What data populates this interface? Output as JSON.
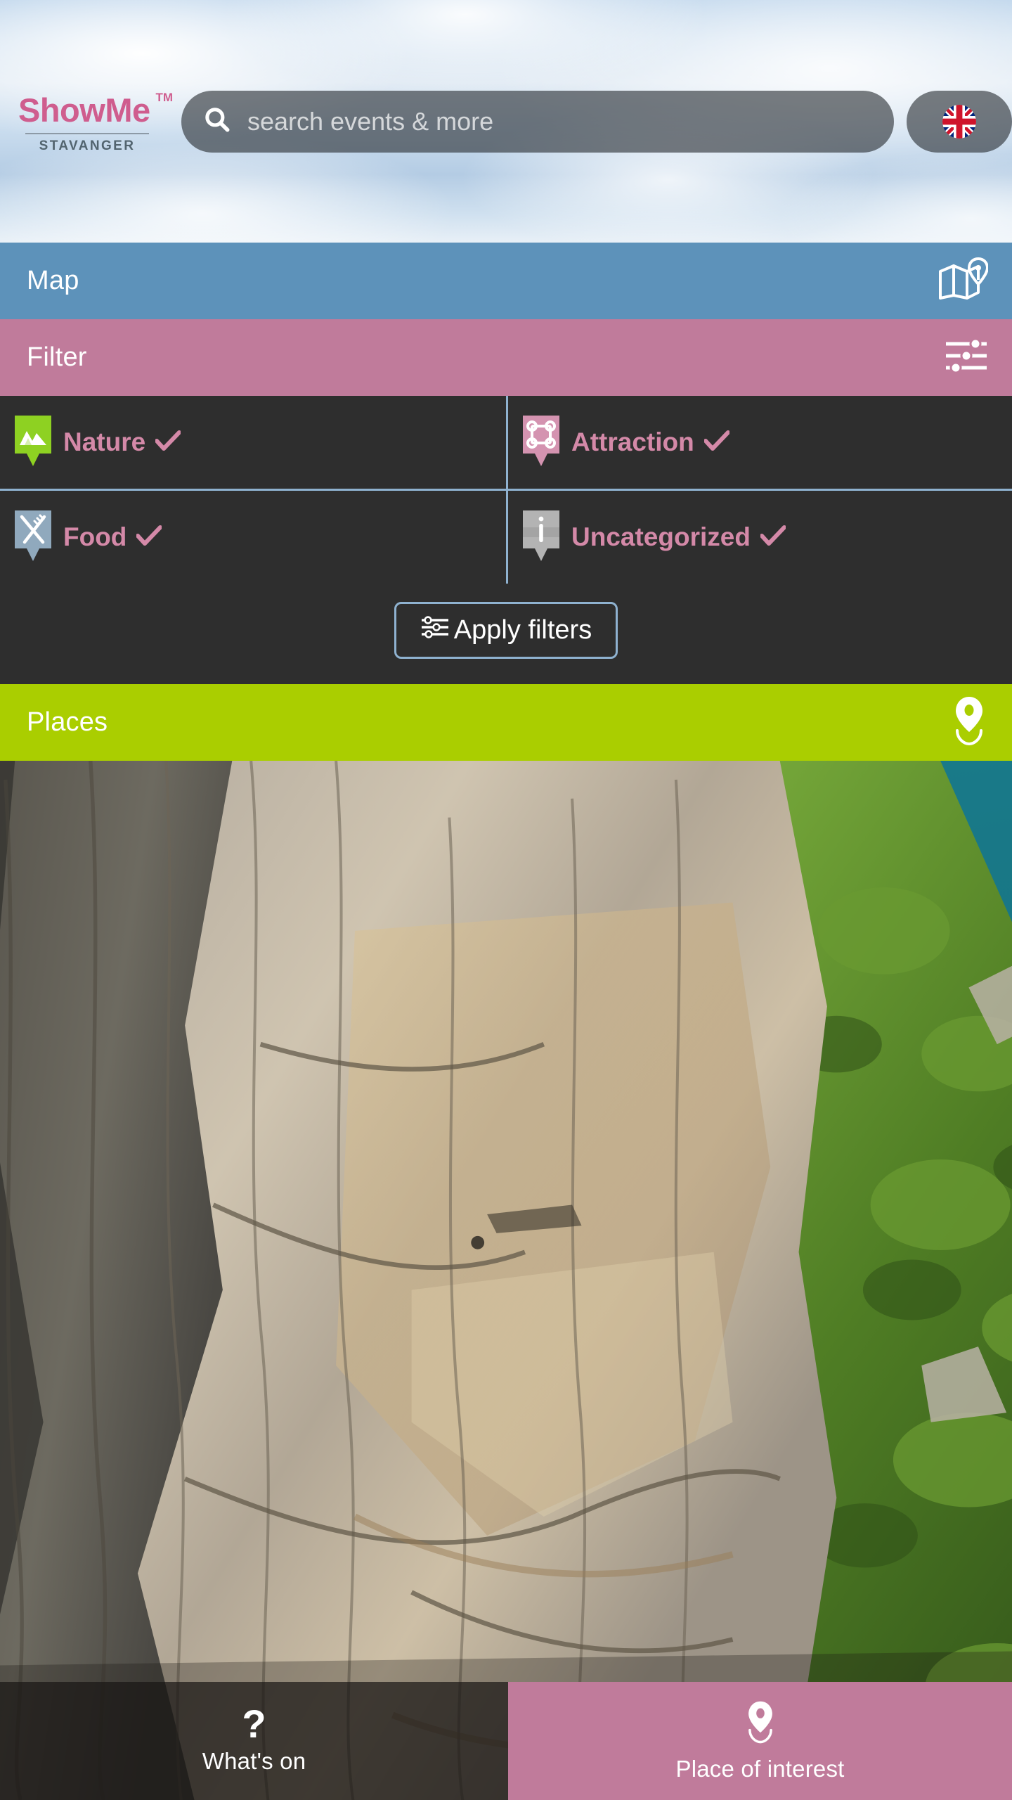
{
  "header": {
    "logo_word": "ShowMe",
    "logo_tm": "TM",
    "logo_city": "STAVANGER",
    "search_placeholder": "search events & more",
    "search_value": "",
    "search_icon": "search-icon",
    "language_flag": "uk-flag-icon",
    "language_code": "EN"
  },
  "sections": {
    "map": {
      "label": "Map",
      "icon": "map-pin-icon",
      "color": "#5d92ba"
    },
    "filter": {
      "label": "Filter",
      "icon": "sliders-icon",
      "color": "#c07b9b"
    },
    "places": {
      "label": "Places",
      "icon": "location-pin-icon",
      "color": "#aace00"
    }
  },
  "filter_panel": {
    "background": "#2e2e2e",
    "divider_color": "#8fb2d0",
    "label_color": "#d489a8",
    "categories": [
      {
        "label": "Nature",
        "icon": "mountains-pin-icon",
        "pin_color": "#8ed122",
        "checked": true,
        "check": "✔"
      },
      {
        "label": "Attraction",
        "icon": "command-pin-icon",
        "pin_color": "#d493b0",
        "checked": true,
        "check": "✔"
      },
      {
        "label": "Food",
        "icon": "cutlery-pin-icon",
        "pin_color": "#90a9bd",
        "checked": true,
        "check": "✔"
      },
      {
        "label": "Uncategorized",
        "icon": "info-pin-icon",
        "pin_color": "#b3b3b3",
        "checked": true,
        "check": "✔"
      }
    ],
    "apply_button": {
      "label": "Apply filters",
      "icon": "sliders-icon",
      "border_color": "#8fb2d0"
    }
  },
  "hero": {
    "alt": "cliff-over-fjord-photo",
    "rock_color": "#9a938a",
    "water_color": "#1f8c99",
    "foliage_color": "#5a8a2c"
  },
  "bottom_nav": [
    {
      "label": "What's on",
      "icon": "question-mark-icon",
      "background": "rgba(24,22,20,0.70)",
      "active": false
    },
    {
      "label": "Place of interest",
      "icon": "location-pin-icon",
      "background": "#c07b9b",
      "active": true
    }
  ]
}
